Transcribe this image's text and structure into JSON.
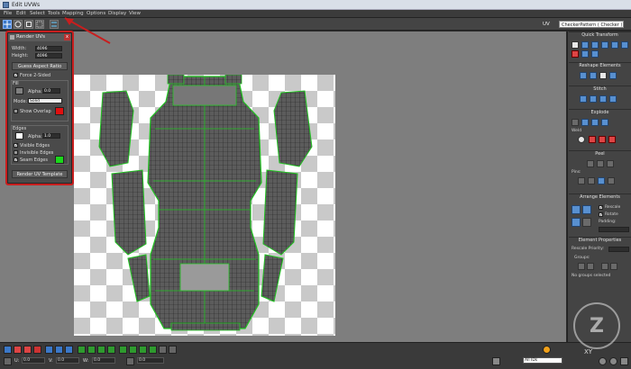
{
  "window": {
    "title": "Edit UVWs"
  },
  "menu": [
    "File",
    "Edit",
    "Select",
    "Tools",
    "Mapping",
    "Options",
    "Display",
    "View"
  ],
  "toolbar": {
    "uv_label": "UV",
    "texture_select": "CheckerPattern ( Checker )"
  },
  "render_dialog": {
    "title": "Render UVs",
    "close": "x",
    "width_label": "Width:",
    "width_value": "4096",
    "height_label": "Height:",
    "height_value": "4096",
    "guess_btn": "Guess Aspect Ratio",
    "force2sided": "Force 2-Sided",
    "fill_label": "Fill",
    "alpha_label": "Alpha:",
    "fill_alpha": "0.0",
    "mode_label": "Mode:",
    "mode_value": "Solid",
    "show_overlap": "Show Overlap",
    "edges_label": "Edges",
    "edge_alpha": "1.0",
    "visible_edges": "Visible Edges",
    "invisible_edges": "Invisible Edges",
    "seam_edges": "Seam Edges",
    "render_btn": "Render UV Template",
    "check_mark": "✓",
    "colors": {
      "overlap": "#e01010",
      "edges": "#ffffff",
      "seam": "#1bd81b",
      "fill": "#808080"
    }
  },
  "right_panel": {
    "quick_transform": "Quick Transform",
    "reshape": "Reshape Elements",
    "stitch": "Stitch",
    "explode": "Explode",
    "weld": "Weld",
    "peel": "Peel",
    "pins": "Pins:",
    "arrange": "Arrange Elements",
    "rescale": "Rescale",
    "rotate": "Rotate",
    "padding": "Padding:",
    "element_props": "Element Properties",
    "rescale_priority": "Rescale Priority:",
    "groups": "Groups:",
    "no_groups": "No groups selected"
  },
  "status": {
    "all_ids": "All IDs",
    "xy": "XY",
    "coord_u": "0.0",
    "coord_v": "0.0",
    "coord_w": "0.0",
    "zoom_val": "0.0"
  },
  "colors": {
    "uv_edge": "#1db51d",
    "uv_fill": "#585858",
    "highlight": "#c81e1e"
  }
}
